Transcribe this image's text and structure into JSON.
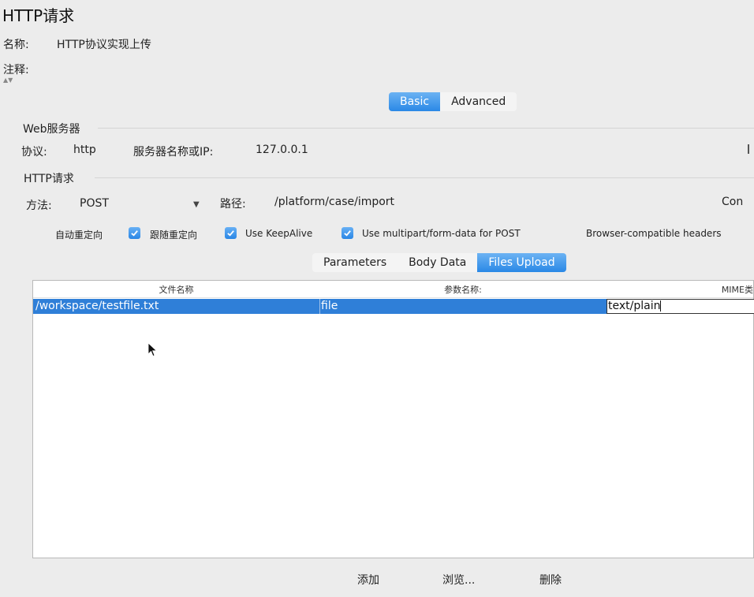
{
  "panel_title": "HTTP请求",
  "name": {
    "label": "名称:",
    "value": "HTTP协议实现上传"
  },
  "comment": {
    "label": "注释:"
  },
  "mode_tabs": [
    {
      "label": "Basic",
      "active": true
    },
    {
      "label": "Advanced",
      "active": false
    }
  ],
  "web_server": {
    "group_label": "Web服务器",
    "protocol_label": "协议:",
    "protocol_value": "http",
    "server_label": "服务器名称或IP:",
    "server_value": "127.0.0.1"
  },
  "http_request": {
    "group_label": "HTTP请求",
    "method_label": "方法:",
    "method_value": "POST",
    "path_label": "路径:",
    "path_value": "/platform/case/import",
    "content_label_cut": "Con"
  },
  "options": [
    {
      "label": "自动重定向",
      "checked": false
    },
    {
      "label": "跟随重定向",
      "checked": true
    },
    {
      "label": "Use KeepAlive",
      "checked": true
    },
    {
      "label": "Use multipart/form-data for POST",
      "checked": true
    },
    {
      "label": "Browser-compatible headers",
      "checked": false
    }
  ],
  "sub_tabs": [
    {
      "label": "Parameters",
      "active": false
    },
    {
      "label": "Body Data",
      "active": false
    },
    {
      "label": "Files Upload",
      "active": true
    }
  ],
  "files_table": {
    "columns": [
      "文件名称",
      "参数名称:",
      "MIME类"
    ],
    "rows": [
      {
        "file": "/workspace/testfile.txt",
        "param": "file",
        "mime": "text/plain"
      }
    ]
  },
  "buttons": {
    "add": "添加",
    "browse": "浏览...",
    "delete": "删除"
  },
  "colors": {
    "accent": "#2f7fd8",
    "background": "#ececec"
  }
}
